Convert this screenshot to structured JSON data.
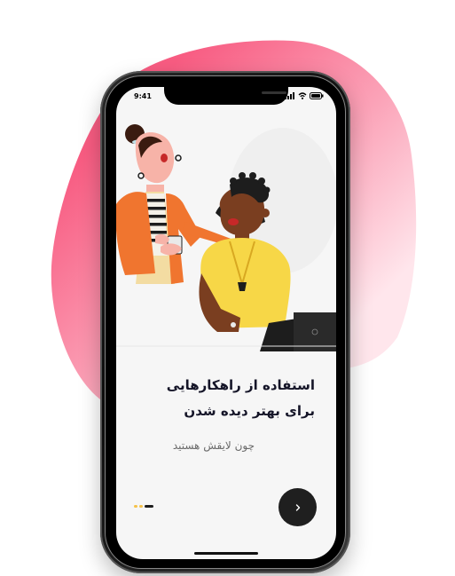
{
  "status_bar": {
    "time": "9:41"
  },
  "onboarding": {
    "title_line1": "استفاده از راهکارهایی",
    "title_line2": "برای بهتر دیده شدن",
    "subtitle": "چون لایقش هستید",
    "page_indicator": {
      "total": 3,
      "active": 3
    },
    "next_icon": "chevron-right-icon"
  },
  "colors": {
    "blob_top": "#F85C82",
    "blob_bottom": "#FFE4EA",
    "title": "#151528",
    "subtitle": "#6A6A6A",
    "accent_dot": "#F5C24A",
    "button": "#1F1F1F",
    "shirt_yellow": "#F7D747",
    "jacket_orange": "#F0752F"
  }
}
